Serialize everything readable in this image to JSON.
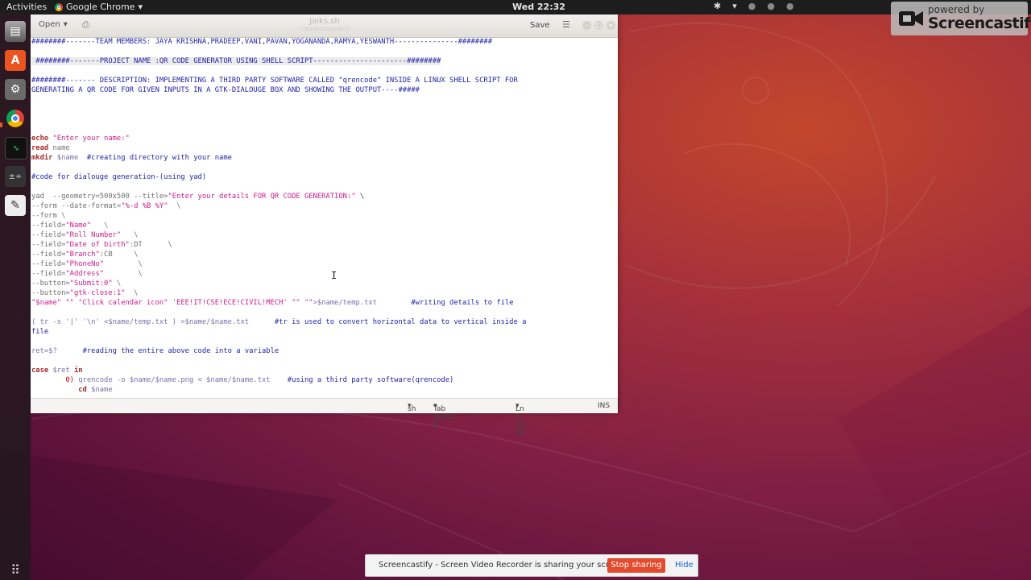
{
  "topbar": {
    "activities": "Activities",
    "app_name": "Google Chrome",
    "app_caret": "▾",
    "clock": "Wed 22:32",
    "tray_icons": [
      "accessibility-icon",
      "network-icon",
      "volume-icon",
      "power-icon"
    ]
  },
  "dock": {
    "items": [
      "files-icon",
      "software-center-icon",
      "settings-icon",
      "chrome-icon",
      "system-monitor-icon",
      "calculator-icon",
      "text-editor-icon",
      "show-apps-icon"
    ]
  },
  "editor": {
    "open_label": "Open",
    "open_caret": "▾",
    "title": "Jaiks.sh",
    "subtitle": "~/Desktop/project",
    "save_label": "Save",
    "menu_glyph": "☰",
    "status": {
      "language": "sh",
      "tab_width": "Tab Width: 8",
      "position": "Ln 3, Col 66",
      "mode": "INS"
    },
    "code": {
      "l1": "########-------TEAM MEMBERS: JAYA KRISHNA,PRADEEP,VANI,PAVAN,YOGANANDA,RAMYA,YESWANTH---------------########",
      "l2": " ########-------PROJECT NAME :QR CODE GENERATOR USING SHELL SCRIPT----------------------########",
      "l3": "########------- DESCRIPTION: IMPLEMENTING A THIRD PARTY SOFTWARE CALLED \"qrencode\" INSIDE A LINUX SHELL SCRIPT FOR",
      "l4": "GENERATING A QR CODE FOR GIVEN INPUTS IN A GTK-DIALOUGE BOX AND SHOWING THE OUTPUT----#####",
      "echo_kw": "echo",
      "echo_str": "\"Enter your name:\"",
      "read_kw": "read",
      "read_arg": "name",
      "mkdir_kw": "mkdir",
      "mkdir_var": "$name",
      "mkdir_comment": "#creating directory with your name",
      "yad_comment": "#code for dialouge generation-(using yad)",
      "yad_cmd": "yad  --geometry=500x500 --title=",
      "yad_title": "\"Enter your details FOR QR CODE GENERATION:\"",
      "yad_cont": " \\",
      "form1_a": "--form --date-format=",
      "form1_s": "\"%-d %B %Y\"",
      "form1_b": "  \\",
      "form2": "--form \\",
      "f1_a": "--field=",
      "f1_s": "\"Name\"",
      "f1_b": "   \\",
      "f2_a": "--field=",
      "f2_s": "\"Roll Number\"",
      "f2_b": "   \\",
      "f3_a": "--field=",
      "f3_s": "\"Date of birth\"",
      "f3_b": ":DT      \\",
      "f4_a": "--field=",
      "f4_s": "\"Branch\"",
      "f4_b": ":CB     \\",
      "f5_a": "--field=",
      "f5_s": "\"PhoneNo\"",
      "f5_b": "        \\",
      "f6_a": "--field=",
      "f6_s": "\"Address\"",
      "f6_b": "        \\",
      "b1_a": "--button=",
      "b1_s": "\"Submit:0\"",
      "b1_b": " \\",
      "b2_a": "--button=",
      "b2_s": "\"gtk-close:1\"",
      "b2_b": "  \\",
      "args_str": "\"$name\" \"\" \"Click calendar icon\" 'EEE!IT!CSE!ECE!CIVIL!MECH' \"\" \"\"",
      "args_redir": ">$name/temp.txt",
      "args_comment": "#writing details to file",
      "tr_code": "( tr -s '|' '\\n' <$name/temp.txt ) >$name/$name.txt",
      "tr_comment": "#tr is used to convert horizontal data to vertical inside a",
      "tr_comment2": "file",
      "ret_code": "ret=$?",
      "ret_comment": "#reading the entire above code into a variable",
      "case_kw": "case",
      "case_var": "$ret",
      "case_in": "in",
      "q_num": "0)",
      "q_code": "qrencode -o $name/$name.png < $name/$name.txt",
      "q_comment": "#using a third party software(qrencode)",
      "cd_kw": "cd",
      "cd_var": "$name"
    }
  },
  "badge": {
    "powered": "powered by",
    "brand": "Screencastify"
  },
  "sharebar": {
    "message": "Screencastify - Screen Video Recorder is sharing your screen.",
    "stop_label": "Stop sharing",
    "hide_label": "Hide"
  }
}
